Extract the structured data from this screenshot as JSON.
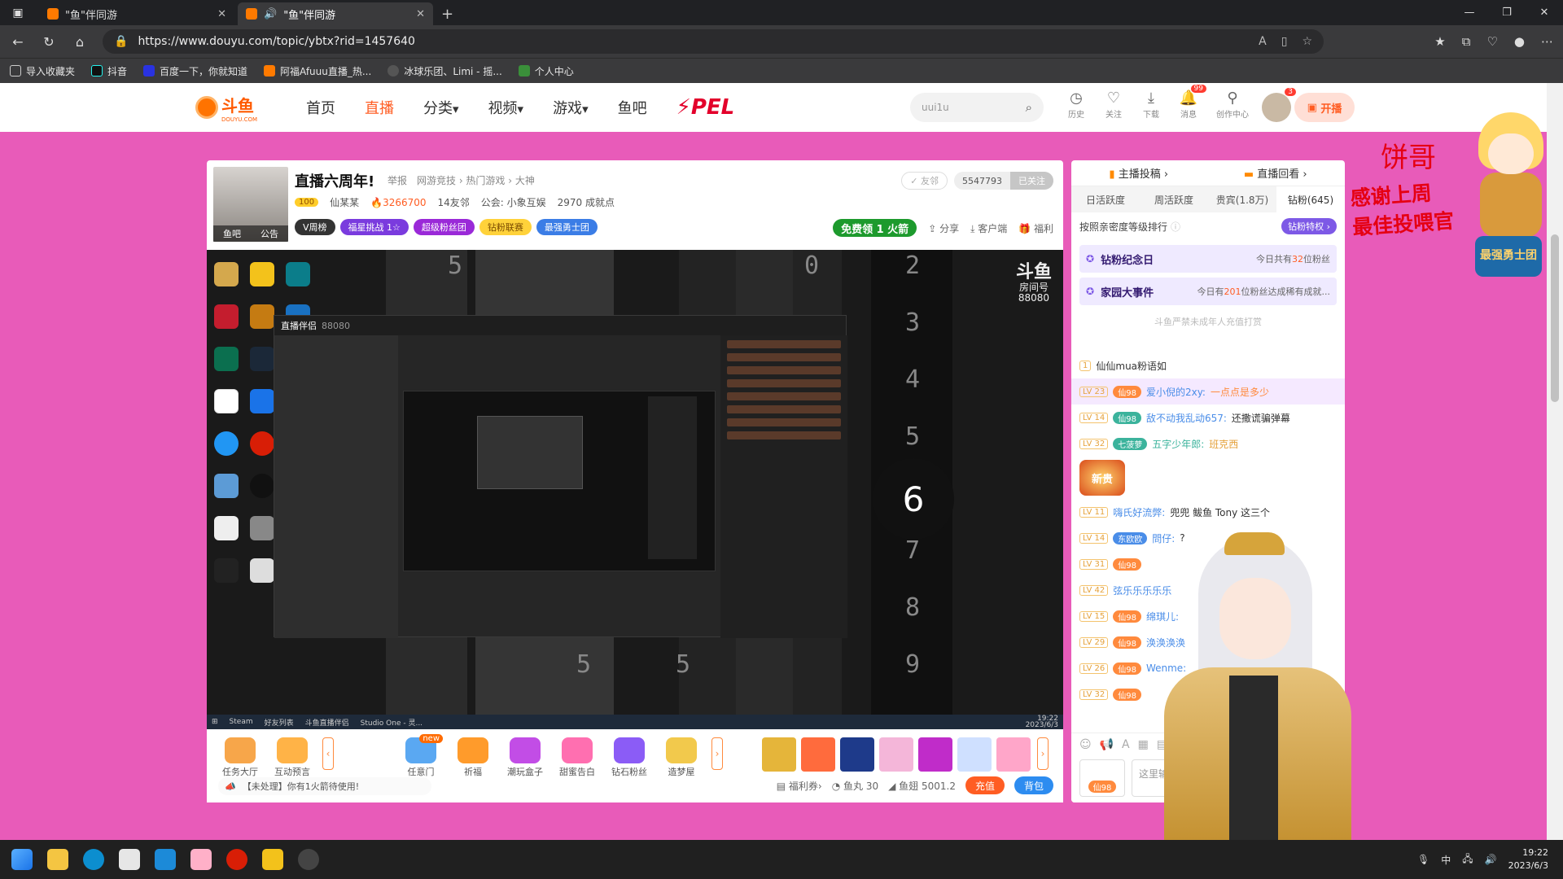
{
  "browser": {
    "tabs": [
      {
        "title": "\"鱼\"伴同游",
        "active": false
      },
      {
        "title": "\"鱼\"伴同游",
        "active": true
      }
    ],
    "url": "https://www.douyu.com/topic/ybtx?rid=1457640",
    "bookmarks": [
      "导入收藏夹",
      "抖音",
      "百度一下，你就知道",
      "阿福Afuuu直播_热...",
      "冰球乐团、Limi - 摇...",
      "个人中心"
    ]
  },
  "nav": {
    "logo": "斗鱼",
    "logo_sub": "DOUYU.COM",
    "items": [
      "首页",
      "直播",
      "分类",
      "视频",
      "游戏",
      "鱼吧"
    ],
    "pel": "PEL",
    "search_placeholder": "uui1u",
    "icons": [
      {
        "label": "历史",
        "badge": ""
      },
      {
        "label": "关注",
        "badge": ""
      },
      {
        "label": "下载",
        "badge": ""
      },
      {
        "label": "消息",
        "badge": "99"
      },
      {
        "label": "创作中心",
        "badge": ""
      }
    ],
    "avatar_badge": "3",
    "kaibo": "开播"
  },
  "room": {
    "title": "直播六周年!",
    "report": "举报",
    "crumbs": "网游竞技 › 热门游戏 › 大神",
    "avatar_tags": [
      "鱼吧",
      "公告"
    ],
    "level": "100",
    "anchor": "仙某某",
    "hot": "3266700",
    "neighbors": "14友邻",
    "guild": "公会: 小象互娱",
    "achievements": "2970 成就点",
    "pills": [
      "V周榜",
      "福星挑战 1☆",
      "超级粉丝团",
      "钻粉联赛",
      "最强勇士团"
    ],
    "friend": "✓ 友邻",
    "follow_count": "5547793",
    "followed": "已关注",
    "free_gift": "免费领 1 火箭",
    "actions": [
      "分享",
      "客户端",
      "福利"
    ]
  },
  "video": {
    "bg_numbers": [
      "5",
      "0",
      "2",
      "3",
      "4",
      "5",
      "7",
      "8",
      "9",
      "5",
      "5"
    ],
    "big_number": "6",
    "watermark_logo": "斗鱼",
    "watermark_label": "房间号",
    "watermark_id": "88080",
    "inner_title": "直播伴侣",
    "inner_room": "88080",
    "inner_taskbar": [
      "Steam",
      "好友列表",
      "斗鱼直播伴侣",
      "Studio One - 灵..."
    ],
    "inner_clock": "19:22",
    "inner_date": "2023/6/3"
  },
  "giftbar": {
    "left_gifts": [
      {
        "label": "任务大厅",
        "tag": ""
      },
      {
        "label": "互动预言",
        "tag": ""
      },
      {
        "label": "任意门",
        "tag": "new"
      },
      {
        "label": "祈福",
        "tag": ""
      },
      {
        "label": "潮玩盒子",
        "tag": ""
      },
      {
        "label": "甜蜜告白",
        "tag": ""
      },
      {
        "label": "钻石粉丝",
        "tag": ""
      },
      {
        "label": "造梦屋",
        "tag": ""
      }
    ],
    "notice": "【未处理】你有1火箭待使用!",
    "welfare": "福利券",
    "fishball": "鱼丸 30",
    "fishfin": "鱼翅 5001.2",
    "recharge": "充值",
    "bag": "背包"
  },
  "chat": {
    "top": [
      "主播投稿 ›",
      "直播回看 ›"
    ],
    "tabs": [
      "日活跃度",
      "周活跃度",
      "贵宾(1.8万)",
      "钻粉(645)"
    ],
    "rank_label": "按照亲密度等级排行",
    "priv": "钻粉特权 ›",
    "cards": [
      {
        "title": "钻粉纪念日",
        "pre": "今日共有",
        "num": "32",
        "post": "位粉丝"
      },
      {
        "title": "家园大事件",
        "pre": "今日有",
        "num": "201",
        "post": "位粉丝达成稀有成就..."
      }
    ],
    "warn": "斗鱼严禁未成年人充值打赏",
    "messages": [
      {
        "lv": "1",
        "fan": "",
        "name": "仙仙mua粉语如",
        "text": "",
        "hl": false
      },
      {
        "lv": "LV 23",
        "fan": "仙98",
        "name": "爱小倪的2xy:",
        "text": "一点点是多少",
        "hl": true
      },
      {
        "lv": "LV 14",
        "fan": "仙98",
        "name": "敌不动我乱动657:",
        "text": "还撒谎骗弹幕",
        "hl": false
      },
      {
        "lv": "LV 32",
        "fan": "七菠萝",
        "name": "五字少年郎:",
        "text": "班克西",
        "hl": false
      },
      {
        "lv": "LV 11",
        "fan": "",
        "name": "嗨氏好流弊:",
        "text": "兜兜 鲅鱼 Tony 这三个",
        "hl": false
      },
      {
        "lv": "LV 14",
        "fan": "东欧欧",
        "name": "問仔:",
        "text": "?",
        "hl": false
      },
      {
        "lv": "LV 31",
        "fan": "仙98",
        "name": "",
        "text": "",
        "hl": false
      },
      {
        "lv": "LV 42",
        "fan": "",
        "name": "弦乐乐乐乐乐",
        "text": "",
        "hl": false
      },
      {
        "lv": "LV 15",
        "fan": "仙98",
        "name": "绵琪儿:",
        "text": "",
        "hl": false
      },
      {
        "lv": "LV 29",
        "fan": "仙98",
        "name": "涣涣涣涣",
        "text": "",
        "hl": false
      },
      {
        "lv": "LV 26",
        "fan": "仙98",
        "name": "Wenme:",
        "text": "",
        "hl": false
      },
      {
        "lv": "LV 32",
        "fan": "仙98",
        "name": "",
        "text": "",
        "hl": false
      }
    ],
    "new_guest": "新贵",
    "input_placeholder": "这里输入聊天",
    "fan_badge": "仙98"
  },
  "overlay": {
    "name": "饼哥",
    "thanks_1": "感谢上周",
    "thanks_2": "最佳投喂官",
    "warrior": "最强勇士团"
  },
  "os": {
    "clock": "19:22",
    "date": "2023/6/3",
    "ime": "中"
  }
}
